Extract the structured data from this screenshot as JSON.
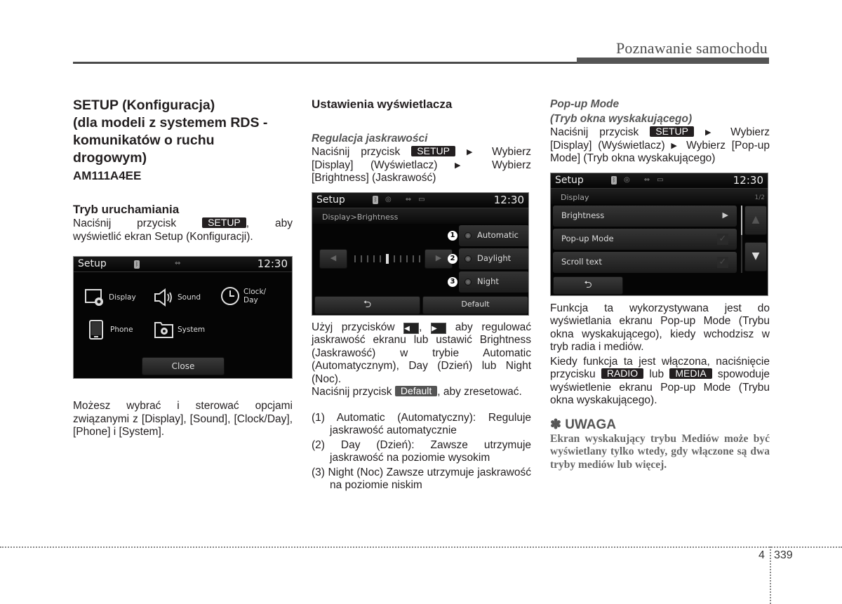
{
  "header": {
    "section_title": "Poznawanie samochodu"
  },
  "col1": {
    "title_lines": [
      "SETUP (Konfiguracja)",
      "(dla modeli z systemem RDS -",
      "komunikatów o ruchu",
      "drogowym)"
    ],
    "code": "AM111A4EE",
    "subheading": "Tryb uruchamiania",
    "para1_before": "Naciśnij przycisk",
    "setup_badge": "SETUP",
    "para1_after_line1": ", aby",
    "para1_line2": "wyświetlić ekran Setup (Konfiguracji).",
    "screen": {
      "title": "Setup",
      "clock": "12:30",
      "menu": [
        {
          "label": "Display",
          "icon": "display-settings-icon"
        },
        {
          "label": "Sound",
          "icon": "speaker-icon"
        },
        {
          "label": "Clock/",
          "label2": "Day",
          "icon": "clock-icon"
        },
        {
          "label": "Phone",
          "icon": "phone-icon"
        },
        {
          "label": "System",
          "icon": "system-folder-icon"
        }
      ],
      "close_label": "Close"
    },
    "para2": "Możesz wybrać i sterować opcjami związanymi z [Display], [Sound], [Clock/Day], [Phone] i [System]."
  },
  "col2": {
    "heading": "Ustawienia wyświetlacza",
    "subheading": "Regulacja jaskrawości",
    "para1_a": "Naciśnij przycisk",
    "setup_badge": "SETUP",
    "para1_b": "Wybierz [Display] (Wyświetlacz)",
    "para1_c": "Wybierz [Brightness] (Jaskrawość)",
    "screen": {
      "title": "Setup",
      "clock": "12:30",
      "breadcrumb": "Display>Brightness",
      "options": [
        {
          "num": "1",
          "label": "Automatic"
        },
        {
          "num": "2",
          "label": "Daylight"
        },
        {
          "num": "3",
          "label": "Night"
        }
      ],
      "brightness_level": 6,
      "brightness_steps": 11,
      "default_label": "Default"
    },
    "para2_a": "Użyj przycisków",
    "left_btn": "◀",
    "right_btn": "▶",
    "para2_b": "aby regulować jaskrawość ekranu lub ustawić Brightness (Jaskrawość) w trybie Automatic (Automatycznym), Day (Dzień) lub Night (Noc).",
    "para3_a": "Naciśnij przycisk",
    "default_badge": "Default",
    "para3_b": ", aby zresetować.",
    "list": [
      {
        "num": "(1)",
        "text": "Automatic (Automatyczny): Reguluje jaskrawość automatycznie"
      },
      {
        "num": "(2)",
        "text": "Day (Dzień): Zawsze utrzymuje jaskrawość na poziomie wysokim"
      },
      {
        "num": "(3)",
        "text": "Night (Noc) Zawsze utrzymuje jaskrawość na poziomie niskim"
      }
    ]
  },
  "col3": {
    "subheading1": "Pop-up Mode",
    "subheading2": "(Tryb okna wyskakującego)",
    "para1_a": "Naciśnij przycisk",
    "setup_badge": "SETUP",
    "para1_b": "Wybierz [Display] (Wyświetlacz)",
    "para1_c": "Wybierz [Pop-up Mode] (Tryb okna wyskakującego)",
    "screen": {
      "title": "Setup",
      "clock": "12:30",
      "breadcrumb": "Display",
      "page": "1/2",
      "items": [
        {
          "label": "Brightness",
          "control": "arrow"
        },
        {
          "label": "Pop-up Mode",
          "control": "checkbox"
        },
        {
          "label": "Scroll text",
          "control": "checkbox"
        }
      ]
    },
    "para2": "Funkcja ta wykorzystywana jest do wyświetlania ekranu Pop-up Mode (Trybu okna wyskakującego), kiedy wchodzisz w tryb radia i mediów.",
    "para3_a": "Kiedy funkcja ta jest włączona, naciśnięcie przycisku",
    "radio_badge": "RADIO",
    "para3_b": "lub",
    "media_badge": "MEDIA",
    "para3_c": "spowoduje wyświetlenie ekranu Pop-up Mode (Trybu okna wyskakującego).",
    "note_title": "✽ UWAGA",
    "note_text": "Ekran wyskakujący trybu Mediów może być wyświetlany tylko wtedy, gdy włączone są dwa tryby mediów lub więcej."
  },
  "footer": {
    "chapter": "4",
    "page": "339"
  }
}
